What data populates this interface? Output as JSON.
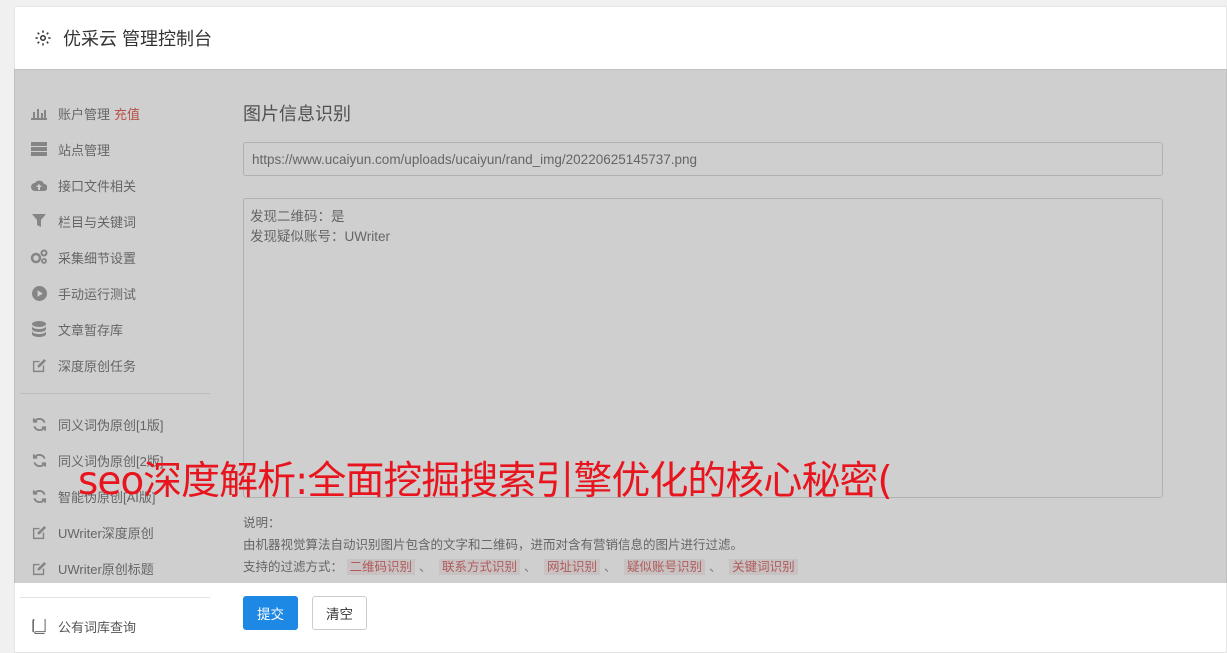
{
  "app": {
    "title": "优采云 管理控制台"
  },
  "sidebar": {
    "group1": [
      {
        "icon": "bar-chart-icon",
        "label": "账户管理",
        "extra": "充值"
      },
      {
        "icon": "server-icon",
        "label": "站点管理"
      },
      {
        "icon": "cloud-upload-icon",
        "label": "接口文件相关"
      },
      {
        "icon": "filter-icon",
        "label": "栏目与关键词"
      },
      {
        "icon": "cogs-icon",
        "label": "采集细节设置"
      },
      {
        "icon": "play-circle-icon",
        "label": "手动运行测试"
      },
      {
        "icon": "database-icon",
        "label": "文章暂存库"
      },
      {
        "icon": "edit-icon",
        "label": "深度原创任务"
      }
    ],
    "group2": [
      {
        "icon": "refresh-icon",
        "label": "同义词伪原创[1版]"
      },
      {
        "icon": "refresh-icon",
        "label": "同义词伪原创[2版]"
      },
      {
        "icon": "refresh-icon",
        "label": "智能伪原创[AI版]"
      },
      {
        "icon": "edit-icon",
        "label": "UWriter深度原创"
      },
      {
        "icon": "edit-icon",
        "label": "UWriter原创标题"
      }
    ],
    "group3": [
      {
        "icon": "book-icon",
        "label": "公有词库查询"
      }
    ]
  },
  "main": {
    "title": "图片信息识别",
    "url_value": "https://www.ucaiyun.com/uploads/ucaiyun/rand_img/20220625145737.png",
    "result_lines": [
      "发现二维码：是",
      "发现疑似账号：UWriter"
    ],
    "desc_label": "说明：",
    "desc_text": "由机器视觉算法自动识别图片包含的文字和二维码，进而对含有营销信息的图片进行过滤。",
    "filter_prefix": "支持的过滤方式：",
    "filters": [
      "二维码识别",
      "联系方式识别",
      "网址识别",
      "疑似账号识别",
      "关键词识别"
    ],
    "submit_label": "提交",
    "clear_label": "清空"
  },
  "overlay": {
    "text": "seo深度解析:全面挖掘搜索引擎优化的核心秘密("
  }
}
